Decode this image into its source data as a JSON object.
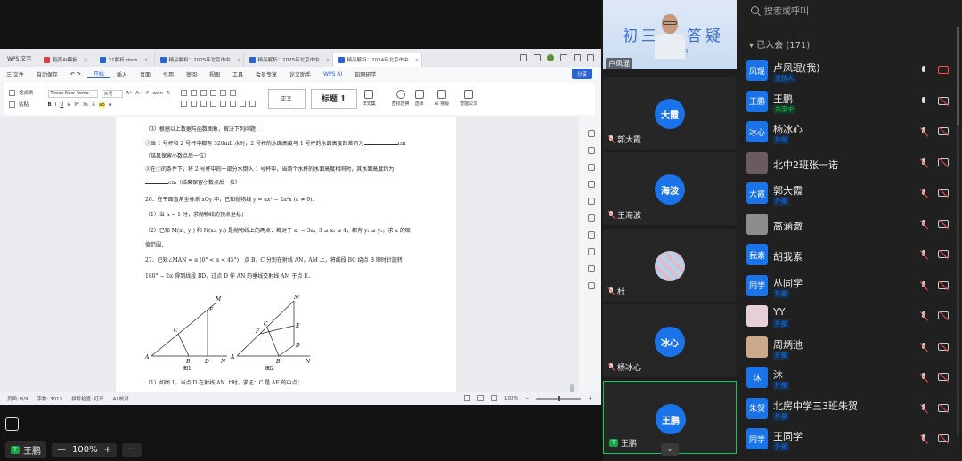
{
  "wps": {
    "app_tab": "WPS 文字",
    "tabs": [
      {
        "label": "稻壳AI模板",
        "color": "#e03a3a"
      },
      {
        "label": "21解析.docx",
        "color": "#2a63d6"
      },
      {
        "label": "精品解析：2025年北京市中",
        "color": "#2a63d6"
      },
      {
        "label": "精品解析：2025年北京市中",
        "color": "#2a63d6"
      },
      {
        "label": "精品解析：2024年北京市中",
        "color": "#2a63d6"
      }
    ],
    "menu": [
      "三 文件",
      "自动保存",
      "开始",
      "插入",
      "页面",
      "引用",
      "审阅",
      "视图",
      "工具",
      "会员专享",
      "论文助手",
      "WPS AI",
      "知网研学"
    ],
    "share_label": "分享",
    "ribbon": {
      "format_painter": "格式刷",
      "paste": "粘贴",
      "font_name": "Times New Roma",
      "font_size": "三号",
      "style_normal": "正文",
      "style_heading": "标题 1",
      "style_set": "样式集",
      "find_replace": "查找替换",
      "select": "选择",
      "ai_format": "AI 排版",
      "smart_doc": "智能公文"
    },
    "doc_lines": [
      "（3）根据以上数据与函数图象，解决下列问题：",
      "①当 1 号杯和 2 号杯中都有 320mL 水时，2 号杯的水面高度与 1 号杯的水面高度的差约为",
      "cm",
      "（结果保留小数点后一位）",
      "②在①的条件下，将 2 号杯中的一部分水倒入 1 号杯中，当两个水杯的水面高度相同时，其水面高度约为",
      "cm（结果保留小数点后一位）",
      "26．在平面直角坐标系 xOy 中，已知抛物线 y = ax² − 2a²x (a ≠ 0)．",
      "（1）当 a = 1 时，求抛物线的顶点坐标；",
      "（2）已知 M(x₁, y₁) 和 N(x₂, y₂) 是抛物线上的两点．若对于 x₁ = 3a，3 ≤ x₂ ≤ 4，都有 y₁ ≤ y₂，求 a 的取",
      "值范围．",
      "27．已知∠MAN = α (0° < α < 45°)，点 B，C 分别在射线 AN，AM 上，将线段 BC 绕点 B 顺时针旋转",
      "180° − 2α 得到线段 BD，过点 D 作 AN 的垂线交射线 AM 于点 E．",
      "（1）如图 1，当点 D 在射线 AN 上时，求证：C 是 AE 的中点；"
    ],
    "figure1": {
      "caption": "图1",
      "labels": [
        "A",
        "B",
        "C",
        "D",
        "E",
        "M",
        "N"
      ]
    },
    "figure2": {
      "caption": "图2",
      "labels": [
        "A",
        "B",
        "C",
        "D",
        "E",
        "F",
        "M",
        "N"
      ]
    },
    "status": {
      "page": "页面: 8/9",
      "words": "字数: 3013",
      "spell": "拼写检查: 打开",
      "ai_check": "AI 校对",
      "zoom": "100%"
    }
  },
  "video": {
    "presenter_banner": "初三",
    "presenter_banner2": "答疑",
    "presenter_sub": "17日",
    "presenter_name": "卢凤琨",
    "tiles": [
      {
        "avatar": "大霞",
        "name": "郭大霞"
      },
      {
        "avatar": "海波",
        "name": "王海波"
      },
      {
        "avatar": "",
        "name": "杜"
      },
      {
        "avatar": "冰心",
        "name": "杨冰心"
      },
      {
        "avatar": "王鹏",
        "name": "王鹏"
      }
    ],
    "more": "⌄"
  },
  "participants": {
    "search_placeholder": "搜索或呼叫",
    "joined_label": "▾ 已入会 (171)",
    "rows": [
      {
        "avatar": "凤琨",
        "name": "卢凤琨(我)",
        "tag": "主持人",
        "mic": "on",
        "cam": "on"
      },
      {
        "avatar": "王鹏",
        "name": "王鹏",
        "tag": "共享中",
        "tag_style": "green",
        "mic": "on",
        "cam": "off"
      },
      {
        "avatar": "冰心",
        "name": "杨冰心",
        "tag": "外部",
        "mic": "off",
        "cam": "off"
      },
      {
        "avatar": "",
        "name": "北中2班张一诺",
        "tag": "",
        "mic": "off",
        "cam": "off",
        "img": "#6b5a60"
      },
      {
        "avatar": "大霞",
        "name": "郭大霞",
        "tag": "外部",
        "mic": "off",
        "cam": "off"
      },
      {
        "avatar": "",
        "name": "高涵澈",
        "tag": "",
        "mic": "off",
        "cam": "off",
        "img": "#8c8c8c"
      },
      {
        "avatar": "我素",
        "name": "胡我素",
        "tag": "",
        "mic": "off",
        "cam": "off"
      },
      {
        "avatar": "同学",
        "name": "丛同学",
        "tag": "外部",
        "mic": "off",
        "cam": "off"
      },
      {
        "avatar": "",
        "name": "YY",
        "tag": "外部",
        "mic": "off",
        "cam": "off",
        "img": "#e6cfd6"
      },
      {
        "avatar": "",
        "name": "周炳池",
        "tag": "外部",
        "mic": "off",
        "cam": "off",
        "img": "#c9a98a"
      },
      {
        "avatar": "沐",
        "name": "沐",
        "tag": "外部",
        "mic": "off",
        "cam": "off"
      },
      {
        "avatar": "朱贺",
        "name": "北房中学三3班朱贺",
        "tag": "外部",
        "mic": "off",
        "cam": "off"
      },
      {
        "avatar": "同学",
        "name": "王同学",
        "tag": "外部",
        "mic": "off",
        "cam": "off"
      }
    ]
  },
  "bottombar": {
    "user": "王鹏",
    "zoom_minus": "—",
    "zoom": "100%",
    "zoom_plus": "+",
    "more": "···"
  },
  "colors": {
    "accent": "#1a73e8",
    "speaking": "#16c75b",
    "muted": "#ff4d4f",
    "wps_blue": "#2a63d6"
  }
}
